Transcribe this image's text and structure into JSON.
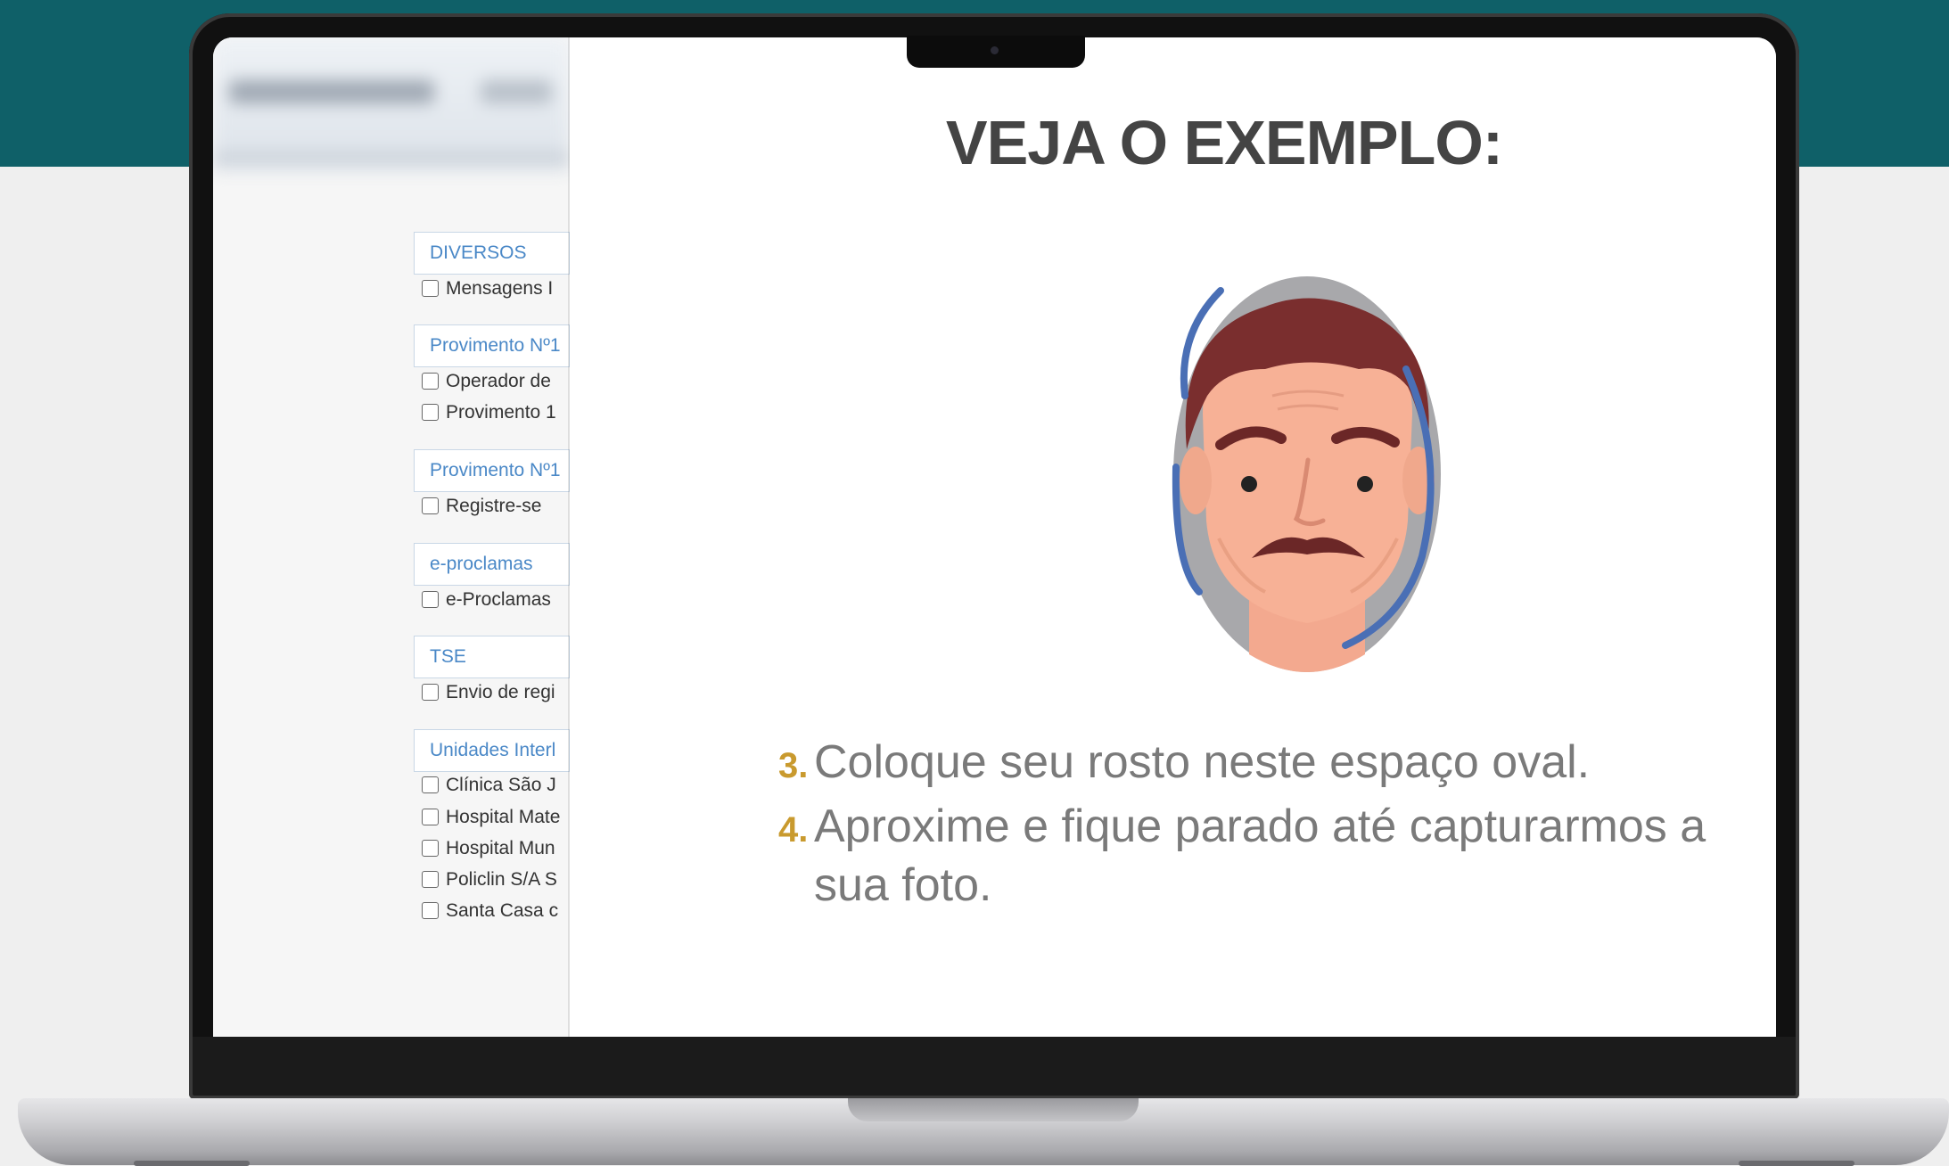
{
  "colors": {
    "brand_teal": "#0f6068",
    "accent_gold": "#c99a2e",
    "link_blue": "#4a88c7"
  },
  "background_app": {
    "sections": [
      {
        "label": "DIVERSOS",
        "items": [
          "Mensagens I"
        ]
      },
      {
        "label": "Provimento Nº1",
        "items": [
          "Operador de",
          "Provimento 1"
        ]
      },
      {
        "label": "Provimento Nº1",
        "items": [
          "Registre-se"
        ]
      },
      {
        "label": "e-proclamas",
        "items": [
          "e-Proclamas"
        ]
      },
      {
        "label": "TSE",
        "items": [
          "Envio de regi"
        ]
      },
      {
        "label": "Unidades Interl",
        "items": [
          "Clínica São J",
          "Hospital Mate",
          "Hospital Mun",
          "Policlin S/A S",
          "Santa Casa c"
        ]
      }
    ]
  },
  "modal": {
    "title": "VEJA O EXEMPLO:",
    "illustration": "face-oval-icon",
    "steps": [
      {
        "number": "3.",
        "text": "Coloque seu rosto neste espaço oval."
      },
      {
        "number": "4.",
        "text": "Aproxime e fique parado até capturarmos a sua foto."
      }
    ]
  }
}
